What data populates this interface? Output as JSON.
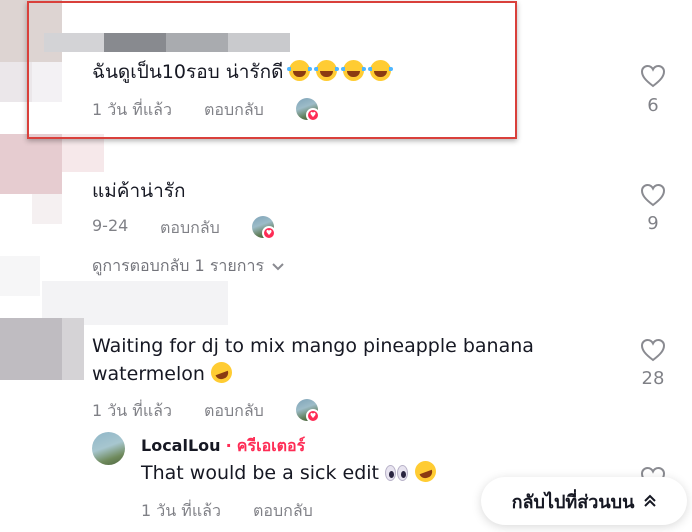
{
  "comments": [
    {
      "text": "ฉันดูเป็น10รอบ น่ารักดี",
      "emoji": [
        "laughing-tears-emoji",
        "laughing-tears-emoji",
        "laughing-tears-emoji",
        "laughing-tears-emoji"
      ],
      "time": "1 วัน ที่แล้ว",
      "reply_label": "ตอบกลับ",
      "likes": "6",
      "highlighted": true
    },
    {
      "text": "แม่ค้าน่ารัก",
      "time": "9-24",
      "reply_label": "ตอบกลับ",
      "likes": "9"
    },
    {
      "text_line1": "Waiting for dj to mix mango pineapple banana",
      "text_line2": "watermelon",
      "emoji": [
        "rofl-emoji"
      ],
      "time": "1 วัน ที่แล้ว",
      "reply_label": "ตอบกลับ",
      "likes": "28"
    }
  ],
  "view_replies": "ดูการตอบกลับ 1 รายการ",
  "reply": {
    "username": "LocalLou",
    "separator": "·",
    "creator_badge": "ครีเอเตอร์",
    "text": "That would be a sick edit",
    "emoji": [
      "eyes-emoji",
      "rofl-emoji"
    ],
    "time": "1 วัน ที่แล้ว",
    "reply_label": "ตอบกลับ"
  },
  "back_to_top": "กลับไปที่ส่วนบน",
  "colors": {
    "accent": "#fe2c55",
    "highlight_border": "#d9403b",
    "muted_text": "#8a8b91"
  }
}
